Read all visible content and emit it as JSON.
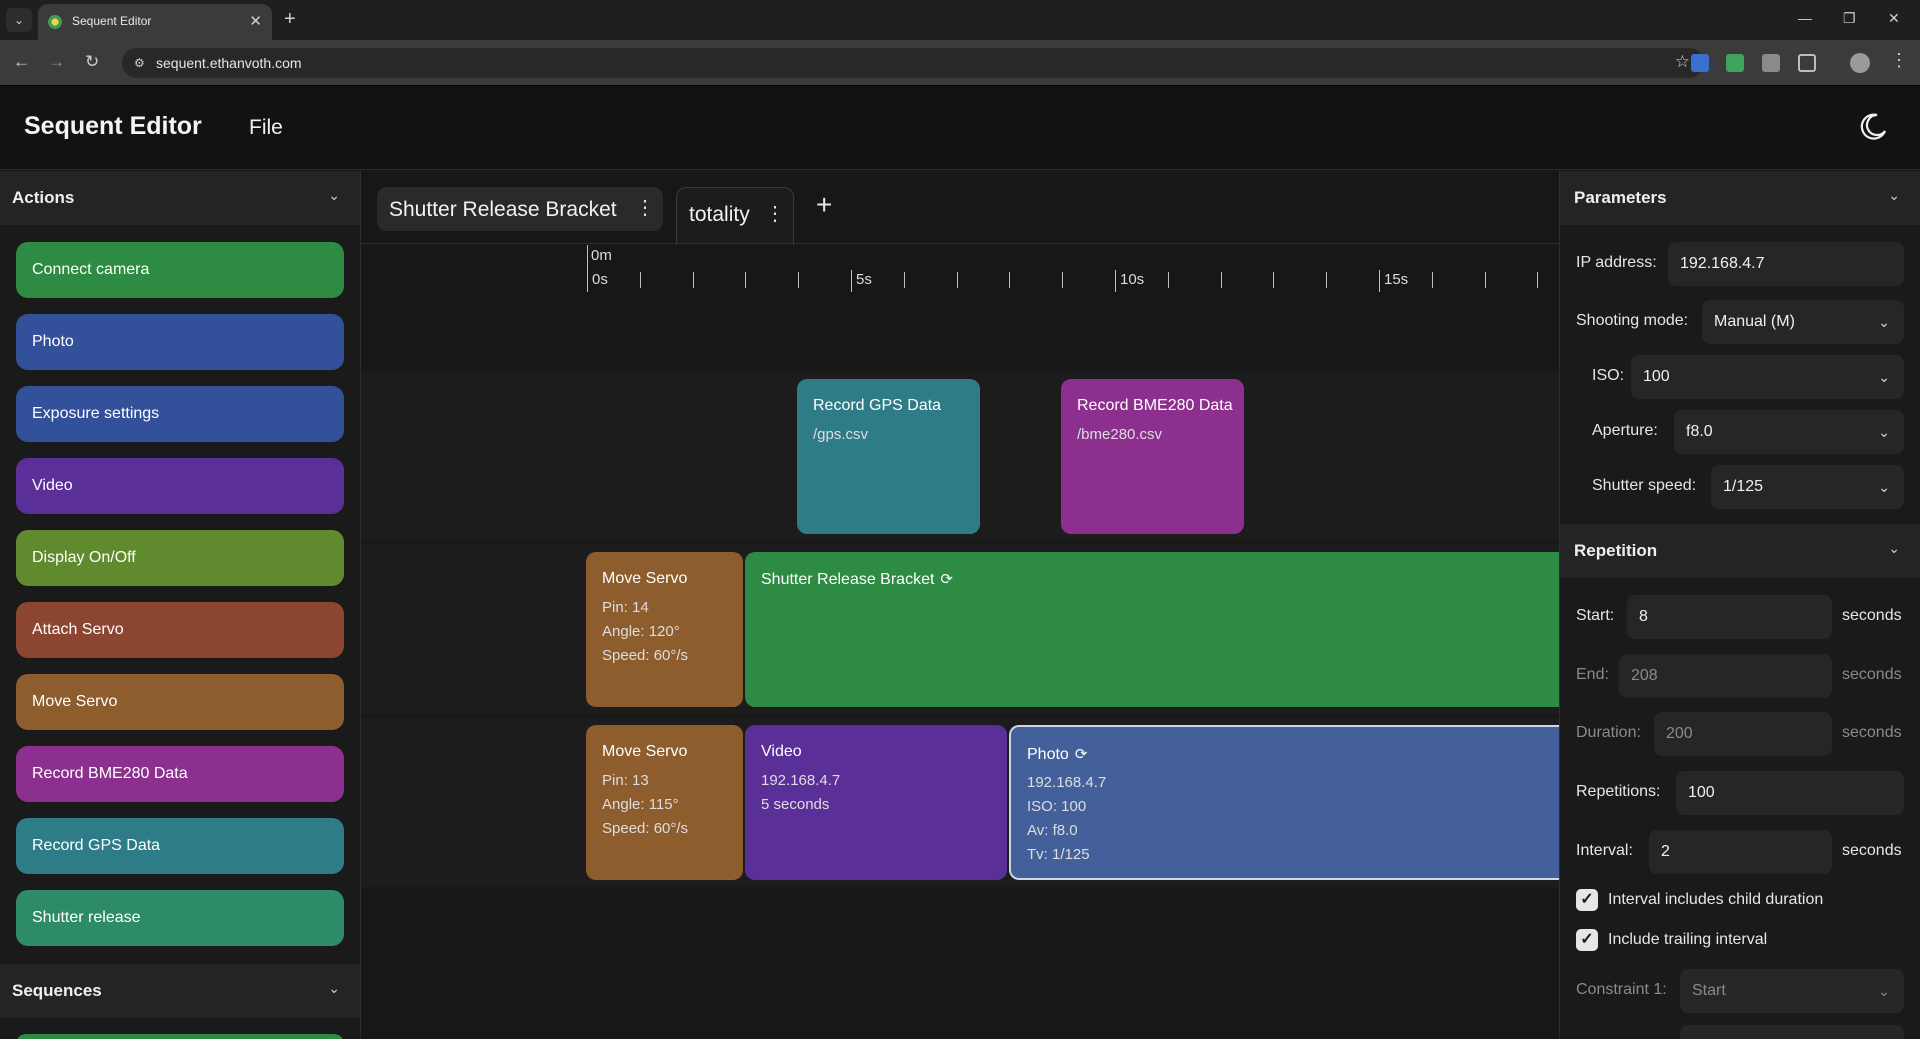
{
  "browser": {
    "tab_title": "Sequent Editor",
    "url": "sequent.ethanvoth.com",
    "tab_list_icon": "chevron-down-icon",
    "close_glyph": "✕",
    "new_tab_glyph": "+",
    "minimize_glyph": "—",
    "restore_glyph": "❐",
    "window_close_glyph": "✕",
    "back_glyph": "←",
    "forward_glyph": "→",
    "reload_glyph": "↻",
    "star_glyph": "☆",
    "menu_glyph": "⋮"
  },
  "app": {
    "title": "Sequent Editor",
    "file_menu": "File",
    "theme_icon": "moon-icon"
  },
  "actions_panel": {
    "heading": "Actions",
    "items": [
      {
        "label": "Connect camera",
        "color": "#2e8b43"
      },
      {
        "label": "Photo",
        "color": "#33509a"
      },
      {
        "label": "Exposure settings",
        "color": "#33509a"
      },
      {
        "label": "Video",
        "color": "#5b2f98"
      },
      {
        "label": "Display On/Off",
        "color": "#5f8a2d"
      },
      {
        "label": "Attach Servo",
        "color": "#8c4530"
      },
      {
        "label": "Move Servo",
        "color": "#8e5d2e"
      },
      {
        "label": "Record BME280 Data",
        "color": "#8d2f8f"
      },
      {
        "label": "Record GPS Data",
        "color": "#2e7c88"
      },
      {
        "label": "Shutter release",
        "color": "#2e8b68"
      }
    ]
  },
  "sequences_panel": {
    "heading": "Sequences"
  },
  "timeline": {
    "tabs": [
      {
        "label": "Shutter Release Bracket",
        "active": false
      },
      {
        "label": "totality",
        "active": true
      }
    ],
    "add_glyph": "+",
    "ruler": {
      "minute_label": "0m",
      "labels": [
        "0s",
        "5s",
        "10s",
        "15s"
      ]
    },
    "blocks": {
      "gps": {
        "title": "Record GPS Data",
        "lines": [
          "/gps.csv"
        ],
        "color": "#2e7c88"
      },
      "bme": {
        "title": "Record BME280 Data",
        "lines": [
          "/bme280.csv"
        ],
        "color": "#8d2f8f"
      },
      "servo1": {
        "title": "Move Servo",
        "lines": [
          "Pin: 14",
          "Angle: 120°",
          "Speed: 60°/s"
        ],
        "color": "#8e5d2e"
      },
      "bracket": {
        "title": "Shutter Release Bracket",
        "lines": [],
        "color": "#2e8b43"
      },
      "servo2": {
        "title": "Move Servo",
        "lines": [
          "Pin: 13",
          "Angle: 115°",
          "Speed: 60°/s"
        ],
        "color": "#8e5d2e"
      },
      "video": {
        "title": "Video",
        "lines": [
          "192.168.4.7",
          "5 seconds"
        ],
        "color": "#5b2f98"
      },
      "photo": {
        "title": "Photo",
        "lines": [
          "192.168.4.7",
          "ISO: 100",
          "Av: f8.0",
          "Tv: 1/125"
        ],
        "color": "#44609a"
      }
    }
  },
  "parameters": {
    "heading": "Parameters",
    "ip_label": "IP address:",
    "ip_value": "192.168.4.7",
    "mode_label": "Shooting mode:",
    "mode_value": "Manual (M)",
    "iso_label": "ISO:",
    "iso_value": "100",
    "aperture_label": "Aperture:",
    "aperture_value": "f8.0",
    "shutter_label": "Shutter speed:",
    "shutter_value": "1/125"
  },
  "repetition": {
    "heading": "Repetition",
    "start_label": "Start:",
    "start_value": "8",
    "end_label": "End:",
    "end_value": "208",
    "duration_label": "Duration:",
    "duration_value": "200",
    "repetitions_label": "Repetitions:",
    "repetitions_value": "100",
    "interval_label": "Interval:",
    "interval_value": "2",
    "unit": "seconds",
    "check1_label": "Interval includes child duration",
    "check1_checked": true,
    "check2_label": "Include trailing interval",
    "check2_checked": true,
    "constraint_label": "Constraint 1:",
    "constraint_value": "Start"
  }
}
